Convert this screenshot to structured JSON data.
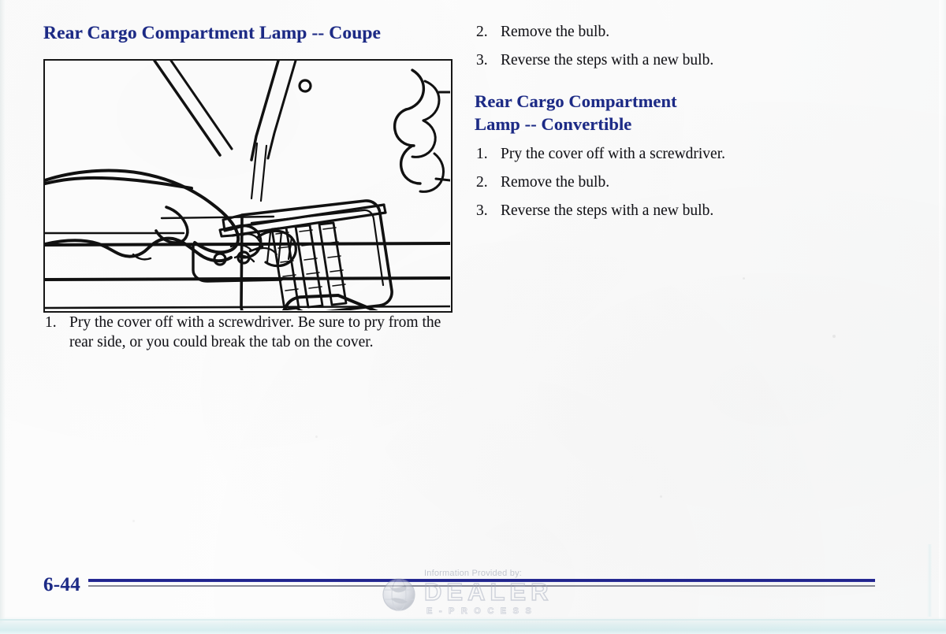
{
  "document": {
    "type": "vehicle-owner-manual-page",
    "page_number": "6-44"
  },
  "left_column": {
    "heading": "Rear Cargo Compartment Lamp -- Coupe",
    "figure": {
      "name": "rear-cargo-compartment-lamp-coupe-illustration",
      "description": "Line drawing of a hand using a screwdriver to pry off a louvered cargo compartment lamp cover"
    },
    "steps": [
      {
        "number": "1.",
        "text": "Pry the cover off with a screwdriver. Be sure to pry from the rear side, or you could break the tab on the cover."
      }
    ]
  },
  "right_column": {
    "steps_continued": [
      {
        "number": "2.",
        "text": "Remove the bulb."
      },
      {
        "number": "3.",
        "text": "Reverse the steps with a new bulb."
      }
    ],
    "heading_line1": "Rear Cargo Compartment",
    "heading_line2": "Lamp -- Convertible",
    "steps": [
      {
        "number": "1.",
        "text": "Pry the cover off with a screwdriver."
      },
      {
        "number": "2.",
        "text": "Remove the bulb."
      },
      {
        "number": "3.",
        "text": "Reverse the steps with a new bulb."
      }
    ]
  },
  "footer": {
    "page_number": "6-44",
    "watermark": {
      "caption": "Information Provided by:",
      "brand": "DEALER",
      "tagline": "E-PROCESS",
      "icon": "globe-icon"
    }
  },
  "colors": {
    "heading": "#1c2a86",
    "body_text": "#15151a",
    "rule_thick": "#1b1f85",
    "rule_thin": "#6f7180",
    "paper": "#fbfbfb",
    "scan_edge": "#dceff1"
  }
}
